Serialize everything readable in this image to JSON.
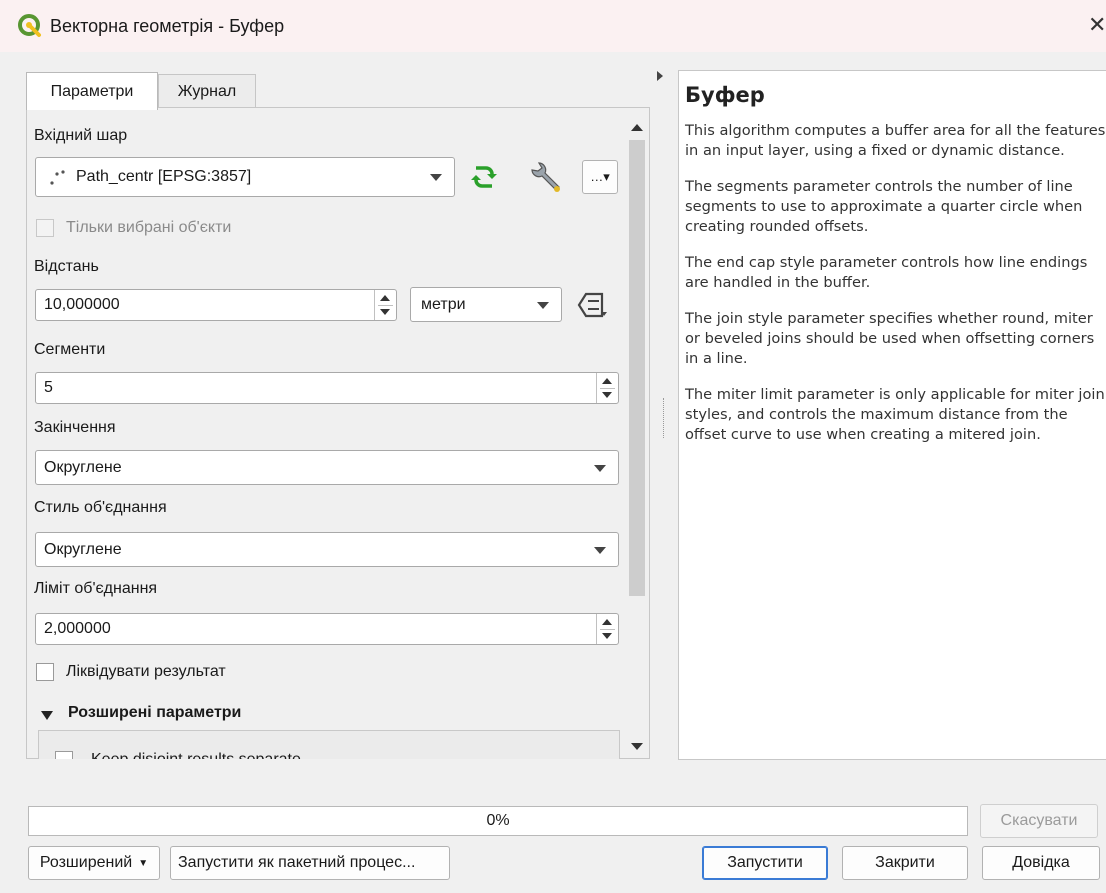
{
  "window": {
    "title": "Векторна геометрія - Буфер",
    "close": "✕"
  },
  "tabs": [
    {
      "label": "Параметри"
    },
    {
      "label": "Журнал"
    }
  ],
  "params": {
    "input_layer": {
      "label": "Вхідний шар",
      "value": "Path_centr [EPSG:3857]"
    },
    "selected_only": {
      "label": "Тільки вибрані об'єкти",
      "checked": false
    },
    "distance": {
      "label": "Відстань",
      "value": "10,000000",
      "unit": "метри"
    },
    "segments": {
      "label": "Сегменти",
      "value": "5"
    },
    "end_cap": {
      "label": "Закінчення",
      "value": "Округлене"
    },
    "join_style": {
      "label": "Стиль об'єднання",
      "value": "Округлене"
    },
    "miter_limit": {
      "label": "Ліміт об'єднання",
      "value": "2,000000"
    },
    "dissolve": {
      "label": "Ліквідувати результат",
      "checked": false
    },
    "advanced": {
      "label": "Розширені параметри",
      "item": "Keep disjoint results separate"
    }
  },
  "help": {
    "title": "Буфер",
    "paragraphs": [
      "This algorithm computes a buffer area for all the features in an input layer, using a fixed or dynamic distance.",
      "The segments parameter controls the number of line segments to use to approximate a quarter circle when creating rounded offsets.",
      "The end cap style parameter controls how line endings are handled in the buffer.",
      "The join style parameter specifies whether round, miter or beveled joins should be used when offsetting corners in a line.",
      "The miter limit parameter is only applicable for miter join styles, and controls the maximum distance from the offset curve to use when creating a mitered join."
    ]
  },
  "progress": {
    "text": "0%",
    "value": 0
  },
  "buttons": {
    "cancel": "Скасувати",
    "advanced": "Розширений",
    "batch": "Запустити як пакетний процес...",
    "run": "Запустити",
    "close": "Закрити",
    "help": "Довідка"
  },
  "icons": {
    "app": "qgis-logo-icon",
    "iterate": "iterate-features-icon",
    "settings": "wrench-icon",
    "data_defined": "data-defined-icon"
  },
  "colors": {
    "accent": "#3a7bd5",
    "qgis_green": "#589632",
    "qgis_yellow": "#f0c020"
  }
}
